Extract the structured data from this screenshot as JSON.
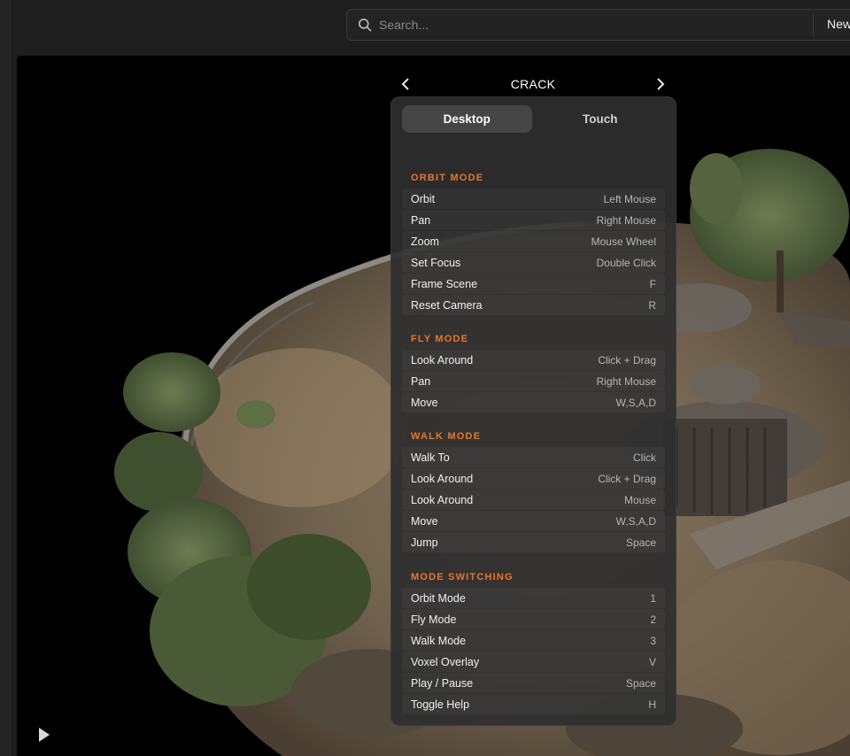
{
  "search": {
    "placeholder": "Search..."
  },
  "header": {
    "new_label": "New"
  },
  "viewer": {
    "title": "CRACK"
  },
  "help": {
    "tabs": [
      {
        "label": "Desktop",
        "active": true
      },
      {
        "label": "Touch",
        "active": false
      }
    ],
    "sections": [
      {
        "title": "ORBIT MODE",
        "rows": [
          {
            "action": "Orbit",
            "key": "Left Mouse"
          },
          {
            "action": "Pan",
            "key": "Right Mouse"
          },
          {
            "action": "Zoom",
            "key": "Mouse Wheel"
          },
          {
            "action": "Set Focus",
            "key": "Double Click"
          },
          {
            "action": "Frame Scene",
            "key": "F"
          },
          {
            "action": "Reset Camera",
            "key": "R"
          }
        ]
      },
      {
        "title": "FLY MODE",
        "rows": [
          {
            "action": "Look Around",
            "key": "Click + Drag"
          },
          {
            "action": "Pan",
            "key": "Right Mouse"
          },
          {
            "action": "Move",
            "key": "W,S,A,D"
          }
        ]
      },
      {
        "title": "WALK MODE",
        "rows": [
          {
            "action": "Walk To",
            "key": "Click"
          },
          {
            "action": "Look Around",
            "key": "Click + Drag"
          },
          {
            "action": "Look Around",
            "key": "Mouse"
          },
          {
            "action": "Move",
            "key": "W,S,A,D"
          },
          {
            "action": "Jump",
            "key": "Space"
          }
        ]
      },
      {
        "title": "MODE SWITCHING",
        "rows": [
          {
            "action": "Orbit Mode",
            "key": "1"
          },
          {
            "action": "Fly Mode",
            "key": "2"
          },
          {
            "action": "Walk Mode",
            "key": "3"
          },
          {
            "action": "Voxel Overlay",
            "key": "V"
          },
          {
            "action": "Play / Pause",
            "key": "Space"
          },
          {
            "action": "Toggle Help",
            "key": "H"
          }
        ]
      }
    ]
  },
  "colors": {
    "accent": "#e8762d",
    "panel_bg": "#2e2e2e",
    "viewport_bg": "#000000"
  },
  "icons": {
    "search": "search-icon",
    "prev": "chevron-left-icon",
    "next": "chevron-right-icon",
    "play": "play-icon"
  }
}
